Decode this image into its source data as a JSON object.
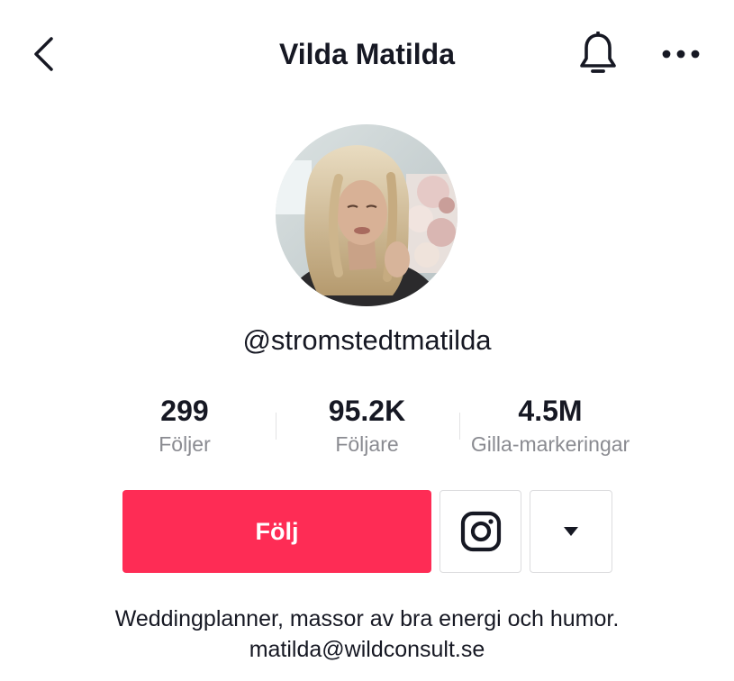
{
  "header": {
    "title": "Vilda Matilda",
    "back_icon": "chevron-left-icon",
    "bell_icon": "bell-icon",
    "more_icon": "more-horizontal-icon"
  },
  "profile": {
    "avatar_icon": "avatar-photo",
    "username": "@stromstedtmatilda"
  },
  "stats": [
    {
      "value": "299",
      "label": "Följer"
    },
    {
      "value": "95.2K",
      "label": "Följare"
    },
    {
      "value": "4.5M",
      "label": "Gilla-markeringar"
    }
  ],
  "actions": {
    "follow_label": "Följ",
    "instagram_icon": "instagram-icon",
    "dropdown_icon": "caret-down-icon"
  },
  "bio": {
    "text": "Weddingplanner, massor av bra energi och humor.",
    "email": "matilda@wildconsult.se"
  },
  "colors": {
    "accent": "#fe2c55",
    "text": "#161823",
    "muted": "#8a8b91"
  }
}
